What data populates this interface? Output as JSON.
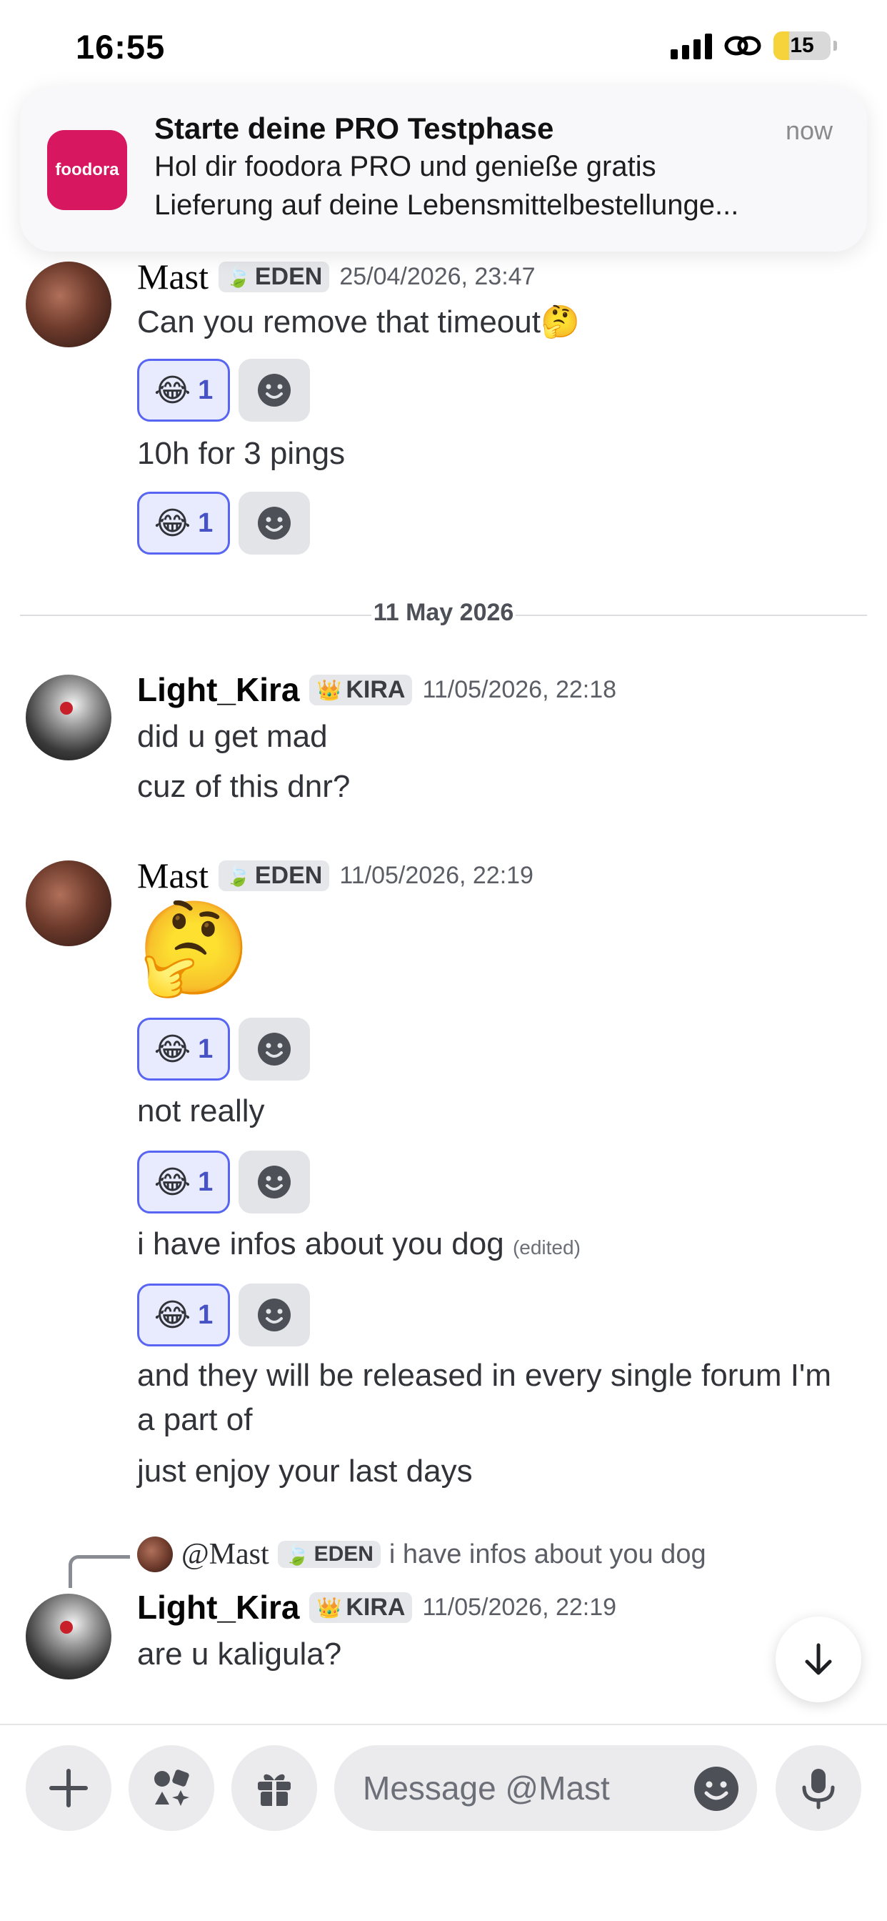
{
  "status_bar": {
    "time": "16:55",
    "battery": "15"
  },
  "notification": {
    "app_label": "foodora",
    "title": "Starte deine PRO Testphase",
    "time": "now",
    "body_line1": "Hol dir foodora PRO und genieße gratis",
    "body_line2": "Lieferung auf deine Lebensmittelbestellunge..."
  },
  "messages": {
    "m1": {
      "author": "Mast",
      "tag": "EDEN",
      "timestamp": "25/04/2026, 23:47",
      "line1": "Can you remove that timeout🤔",
      "r1": {
        "emoji": "😂",
        "count": "1"
      },
      "line2": "10h for 3 pings",
      "r2": {
        "emoji": "😂",
        "count": "1"
      }
    },
    "date_divider": "11 May 2026",
    "m2": {
      "author": "Light_Kira",
      "tag": "KIRA",
      "timestamp": "11/05/2026, 22:18",
      "line1": "did u get mad",
      "line2": "cuz of this dnr?"
    },
    "m3": {
      "author": "Mast",
      "tag": "EDEN",
      "timestamp": "11/05/2026, 22:19",
      "big_emoji": "🤔",
      "r1": {
        "emoji": "😂",
        "count": "1"
      },
      "line1": "not really",
      "r2": {
        "emoji": "😂",
        "count": "1"
      },
      "line2": "i have infos about you dog",
      "edited": "(edited)",
      "r3": {
        "emoji": "😂",
        "count": "1"
      },
      "line3": "and they will be released in every single forum I'm",
      "line4": "a part of",
      "line5": "just enjoy your last days"
    },
    "m4": {
      "reply_author": "@Mast",
      "reply_tag": "EDEN",
      "reply_text": "i have infos about you dog",
      "author": "Light_Kira",
      "tag": "KIRA",
      "timestamp": "11/05/2026, 22:19",
      "line1": "are u kaligula?"
    }
  },
  "composer": {
    "placeholder": "Message @Mast"
  },
  "icons": {
    "tag_eden": "leaf-icon",
    "tag_kira": "crown-icon",
    "composer": [
      "plus-icon",
      "apps-icon",
      "gift-icon",
      "emoji-icon",
      "microphone-icon"
    ],
    "scroll": "arrow-down-icon"
  },
  "colors": {
    "accent": "#5865f2",
    "foodora": "#d7175f",
    "reaction_bg": "#e8eafd"
  }
}
